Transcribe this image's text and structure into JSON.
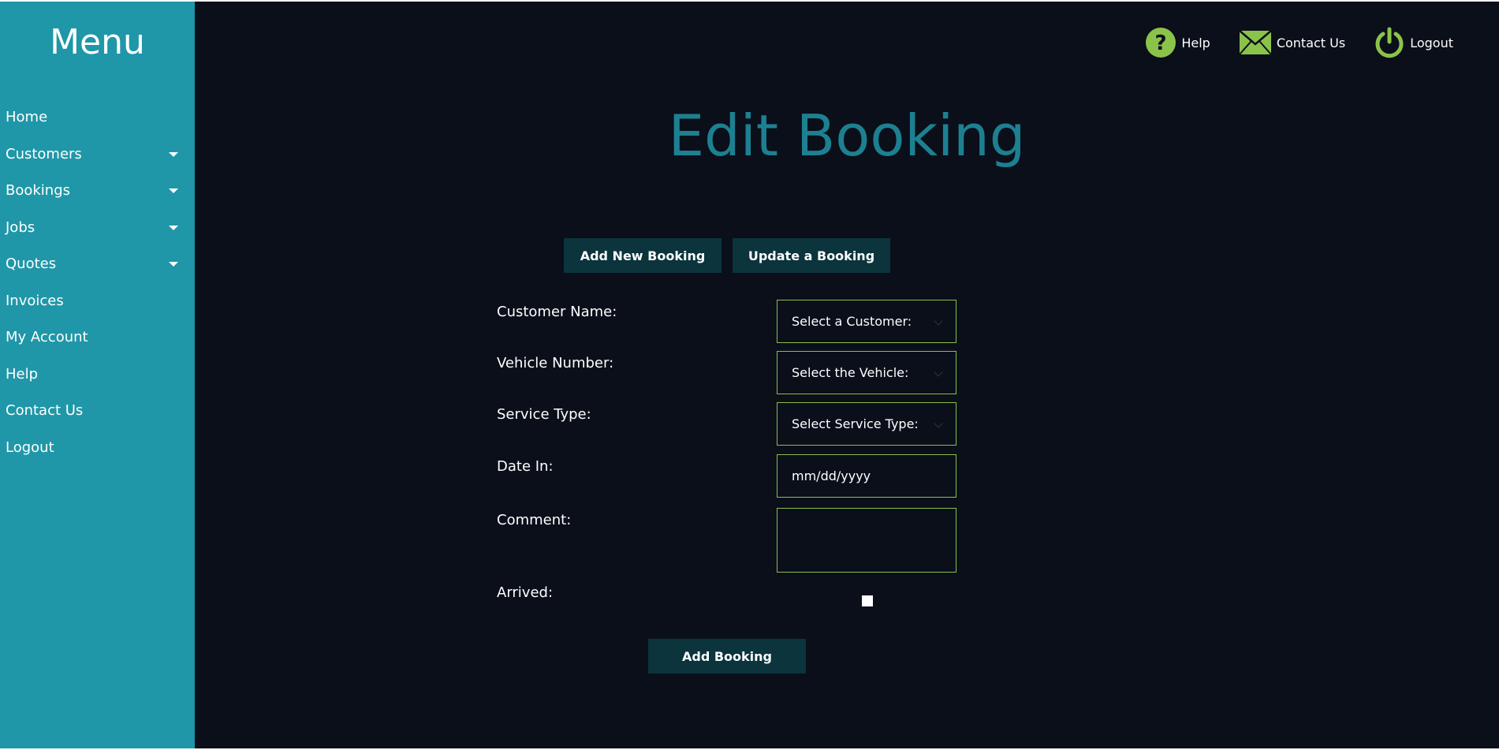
{
  "sidebar": {
    "title": "Menu",
    "items": [
      {
        "label": "Home"
      },
      {
        "label": "Customers"
      },
      {
        "label": "Bookings"
      },
      {
        "label": "Jobs"
      },
      {
        "label": "Quotes"
      },
      {
        "label": "Invoices"
      },
      {
        "label": "My Account"
      },
      {
        "label": "Help"
      },
      {
        "label": "Contact Us"
      },
      {
        "label": "Logout"
      }
    ]
  },
  "topbar": {
    "help_label": "Help",
    "contact_label": "Contact Us",
    "logout_label": "Logout",
    "icon_color": "#8bc34a"
  },
  "main": {
    "title": "Edit Booking",
    "tabs": {
      "add_new": "Add New Booking",
      "update": "Update a Booking"
    },
    "form": {
      "customer_label": "Customer Name:",
      "customer_value": "Select a Customer:",
      "vehicle_label": "Vehicle Number:",
      "vehicle_value": "Select the Vehicle:",
      "service_label": "Service Type:",
      "service_value": "Select Service Type:",
      "date_label": "Date In:",
      "date_placeholder": "mm/dd/yyyy",
      "comment_label": "Comment:",
      "comment_value": "",
      "arrived_label": "Arrived:",
      "arrived_checked": false
    },
    "submit_label": "Add Booking"
  },
  "colors": {
    "sidebar_bg": "#1f97a8",
    "page_bg": "#0a0f1a",
    "title": "#1d8091",
    "button_bg": "#0b343c",
    "field_border": "#8bbf4a"
  }
}
